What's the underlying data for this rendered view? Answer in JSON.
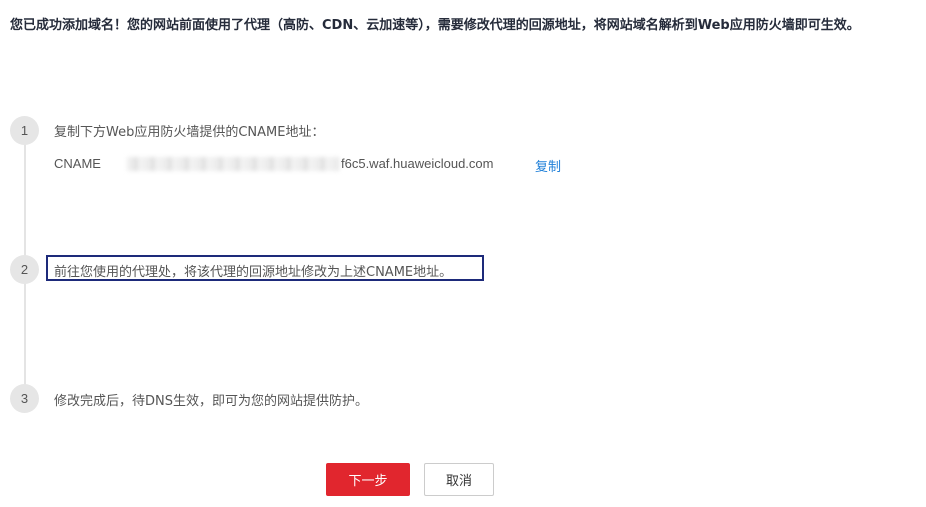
{
  "headline": "您已成功添加域名！您的网站前面使用了代理（高防、CDN、云加速等），需要修改代理的回源地址，将网站域名解析到Web应用防火墙即可生效。",
  "steps": [
    {
      "number": "1",
      "text": "复制下方Web应用防火墙提供的CNAME地址："
    },
    {
      "number": "2",
      "text": "前往您使用的代理处，将该代理的回源地址修改为上述CNAME地址。"
    },
    {
      "number": "3",
      "text": "修改完成后，待DNS生效，即可为您的网站提供防护。"
    }
  ],
  "cname": {
    "label": "CNAME",
    "value_visible": "f6c5.waf.huaweicloud.com",
    "copy_label": "复制"
  },
  "buttons": {
    "next_label": "下一步",
    "cancel_label": "取消"
  },
  "colors": {
    "primary": "#e1262e",
    "link": "#1e7fd8",
    "highlight_border": "#1d2a7a"
  }
}
